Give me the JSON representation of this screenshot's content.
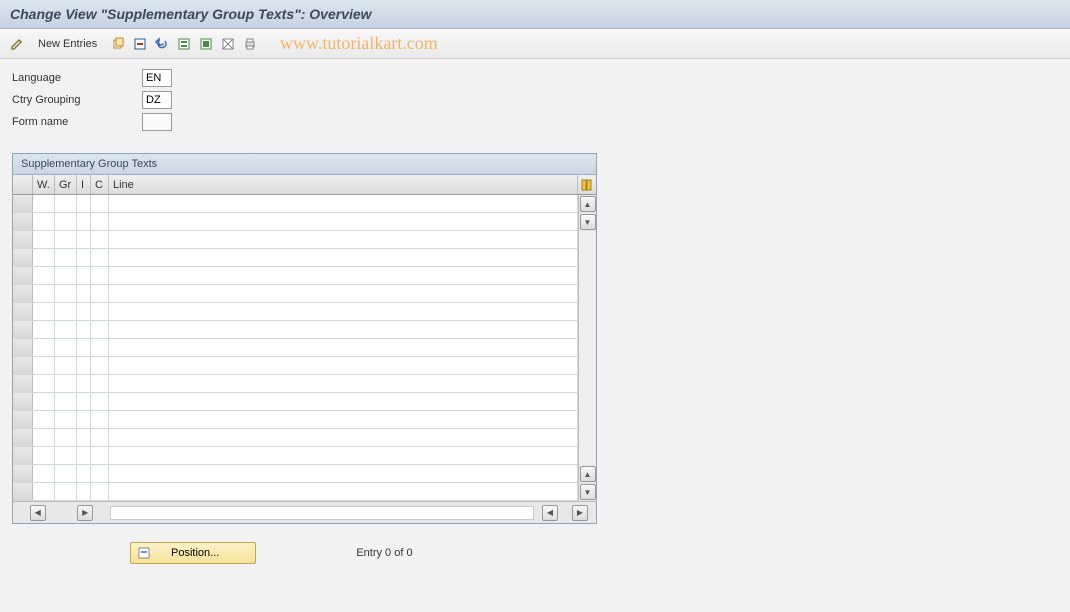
{
  "title": "Change View \"Supplementary Group Texts\": Overview",
  "toolbar": {
    "new_entries_label": "New Entries"
  },
  "watermark": "www.tutorialkart.com",
  "form": {
    "language_label": "Language",
    "language_value": "EN",
    "ctry_grouping_label": "Ctry Grouping",
    "ctry_grouping_value": "DZ",
    "form_name_label": "Form name",
    "form_name_value": ""
  },
  "table": {
    "title": "Supplementary Group Texts",
    "columns": {
      "w": "W.",
      "gr": "Gr",
      "i": "I",
      "c": "C",
      "line": "Line"
    },
    "row_count": 17
  },
  "footer": {
    "position_label": "Position...",
    "entry_text": "Entry 0 of 0"
  }
}
